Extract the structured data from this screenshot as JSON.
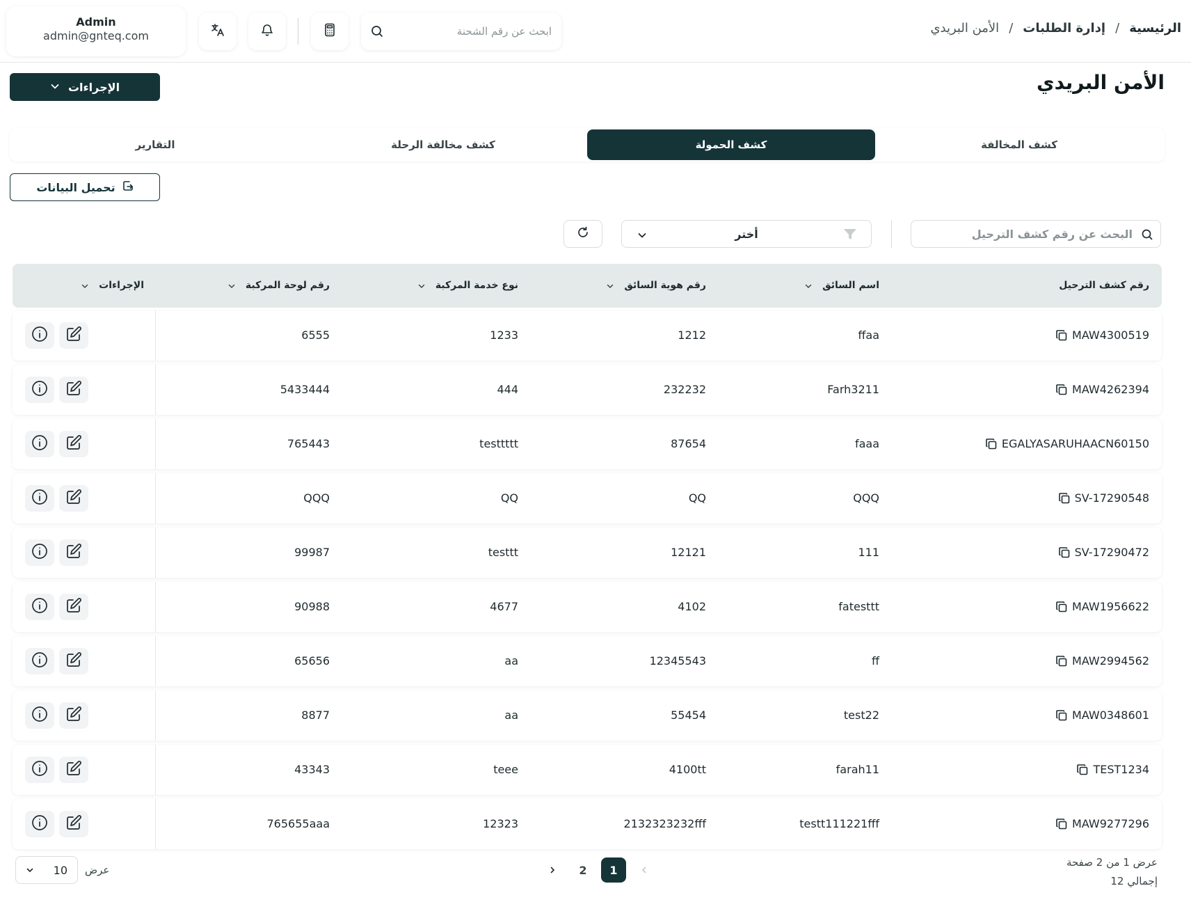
{
  "header": {
    "user_name": "Admin",
    "user_email": "admin@gnteq.com",
    "search_placeholder": "ابحث عن رقم الشحنة",
    "icons": [
      "translate-icon",
      "bell-icon",
      "calculator-icon",
      "search-icon"
    ]
  },
  "breadcrumb": {
    "home": "الرئيسية",
    "section": "إدارة الطلبات",
    "current": "الأمن البريدي",
    "separator": "/"
  },
  "page": {
    "title": "الأمن البريدي",
    "actions_label": "الإجراءات",
    "download_label": "تحميل البيانات"
  },
  "tabs": [
    {
      "label": "كشف المخالفة",
      "active": false
    },
    {
      "label": "كشف الحمولة",
      "active": true
    },
    {
      "label": "كشف مخالفة الرحلة",
      "active": false
    },
    {
      "label": "التقارير",
      "active": false
    }
  ],
  "filters": {
    "search_placeholder": "البحث عن رقم كشف الترحيل",
    "select_value": "أختر"
  },
  "table": {
    "columns": [
      "رقم كشف الترحيل",
      "اسم السائق",
      "رقم هوية السائق",
      "نوع خدمة المركبة",
      "رقم لوحة المركبة",
      "الإجراءات"
    ],
    "rows": [
      [
        "MAW4300519",
        "ffaa",
        "1212",
        "1233",
        "6555"
      ],
      [
        "MAW4262394",
        "Farh3211",
        "232232",
        "444",
        "5433444"
      ],
      [
        "EGALYASARUHAACN60150",
        "faaa",
        "87654",
        "testtttt",
        "765443"
      ],
      [
        "SV-17290548",
        "QQQ",
        "QQ",
        "QQ",
        "QQQ"
      ],
      [
        "SV-17290472",
        "111",
        "12121",
        "testtt",
        "99987"
      ],
      [
        "MAW1956622",
        "fatesttt",
        "4102",
        "4677",
        "90988"
      ],
      [
        "MAW2994562",
        "ff",
        "12345543",
        "aa",
        "65656"
      ],
      [
        "MAW0348601",
        "test22",
        "55454",
        "aa",
        "8877"
      ],
      [
        "TEST1234",
        "farah11",
        "4100tt",
        "teee",
        "43343"
      ],
      [
        "MAW9277296",
        "testt111221fff",
        "2132323232fff",
        "12323",
        "765655aaa"
      ]
    ]
  },
  "pagination": {
    "showing": "عرض 1 من 2 صفحة",
    "total": "إجمالي 12",
    "pages": [
      "1",
      "2"
    ],
    "current_page": "1",
    "per_page_label": "عرض",
    "per_page_value": "10"
  }
}
